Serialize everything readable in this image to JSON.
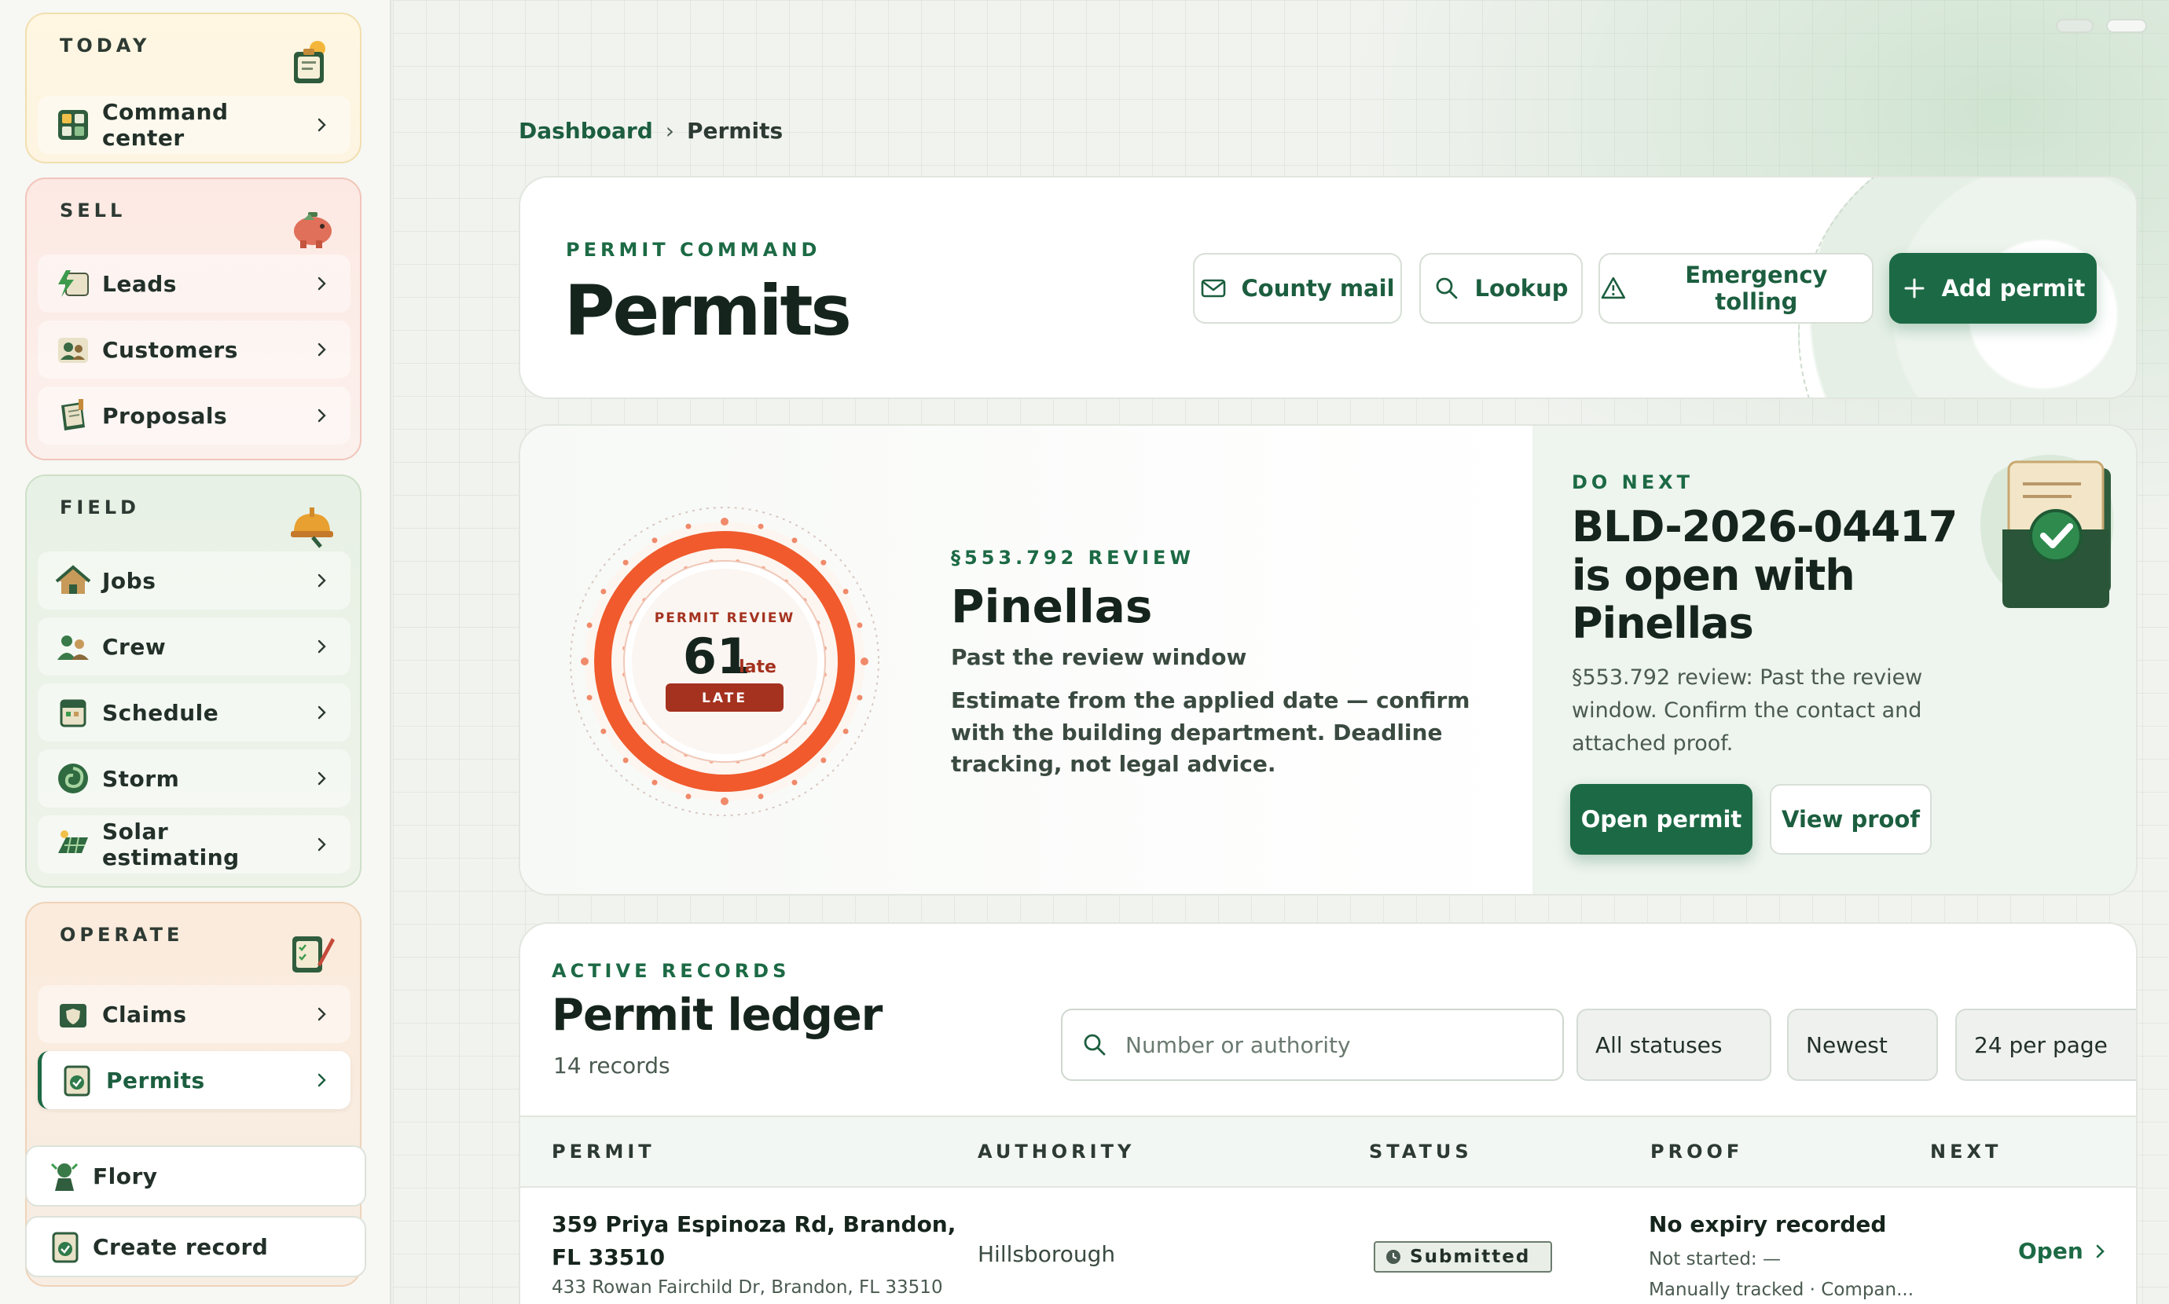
{
  "sidebar": {
    "groups": [
      {
        "title": "TODAY",
        "items": [
          {
            "label": "Command center"
          }
        ]
      },
      {
        "title": "SELL",
        "items": [
          {
            "label": "Leads"
          },
          {
            "label": "Customers"
          },
          {
            "label": "Proposals"
          }
        ]
      },
      {
        "title": "FIELD",
        "items": [
          {
            "label": "Jobs"
          },
          {
            "label": "Crew"
          },
          {
            "label": "Schedule"
          },
          {
            "label": "Storm"
          },
          {
            "label": "Solar estimating"
          }
        ]
      },
      {
        "title": "OPERATE",
        "items": [
          {
            "label": "Claims"
          },
          {
            "label": "Permits",
            "active": true
          }
        ]
      }
    ],
    "bottom": [
      {
        "label": "Flory"
      },
      {
        "label": "Create record"
      }
    ]
  },
  "breadcrumb": {
    "parent": "Dashboard",
    "separator": "›",
    "current": "Permits"
  },
  "header": {
    "eyebrow": "PERMIT COMMAND",
    "title": "Permits",
    "actions": {
      "county_mail": "County mail",
      "lookup": "Lookup",
      "emergency_tolling": "Emergency tolling",
      "add_permit": "Add permit"
    }
  },
  "hero": {
    "dial": {
      "caption": "PERMIT REVIEW",
      "value": "61",
      "unit": "late",
      "badge": "LATE"
    },
    "eyebrow": "§553.792 REVIEW",
    "title": "Pinellas",
    "subtitle": "Past the review window",
    "description": "Estimate from the applied date — confirm with the building department. Deadline tracking, not legal advice.",
    "next": {
      "eyebrow": "DO NEXT",
      "title": "BLD-2026-04417 is open with Pinellas",
      "description": "§553.792 review: Past the review window. Confirm the contact and attached proof.",
      "open_label": "Open permit",
      "proof_label": "View proof"
    }
  },
  "ledger": {
    "eyebrow": "ACTIVE RECORDS",
    "title": "Permit ledger",
    "count": "14 records",
    "search_placeholder": "Number or authority",
    "filters": {
      "status": "All statuses",
      "sort": "Newest",
      "per_page": "24 per page"
    },
    "columns": {
      "permit": "PERMIT",
      "authority": "AUTHORITY",
      "status": "STATUS",
      "proof": "PROOF",
      "next": "NEXT"
    },
    "rows": [
      {
        "address": "359 Priya Espinoza Rd, Brandon, FL 33510",
        "sub": "433 Rowan Fairchild Dr, Brandon, FL 33510",
        "authority": "Hillsborough",
        "status": "Submitted",
        "proof_main": "No expiry recorded",
        "proof_line1": "Not started: —",
        "proof_line2": "Manually tracked · Compan...",
        "next": "Open"
      }
    ]
  },
  "colors": {
    "accent": "#1c6a45",
    "late": "#f05a2c",
    "late_badge": "#a4321f"
  }
}
